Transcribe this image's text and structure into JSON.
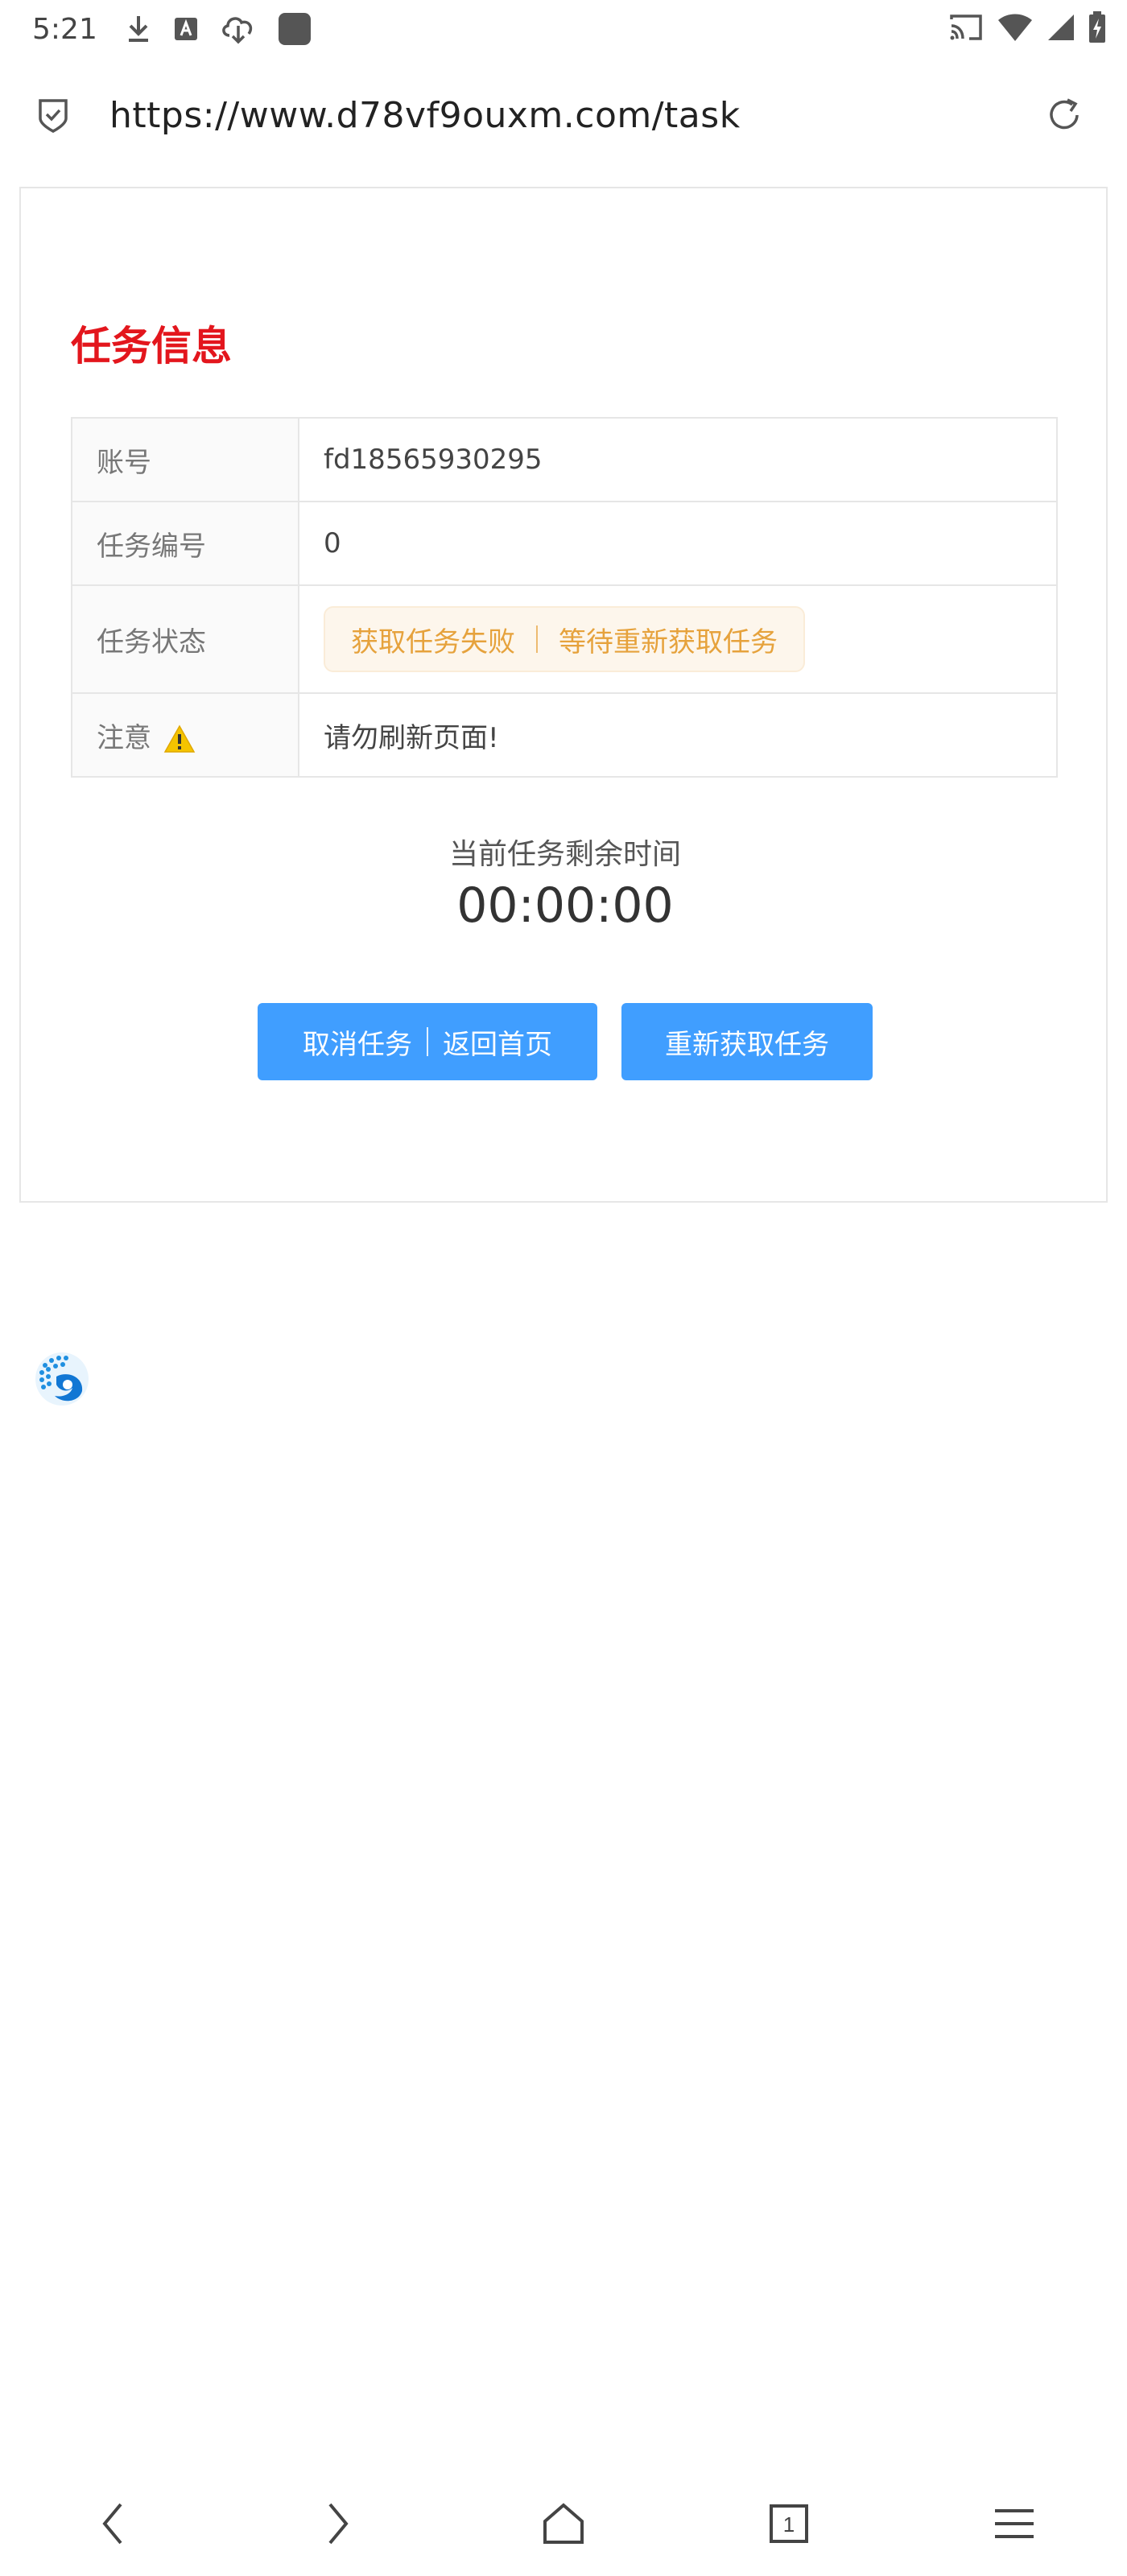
{
  "status_bar": {
    "time": "5:21",
    "left_icons": [
      "download-icon",
      "font-a-icon",
      "cloud-download-icon",
      "app-square-icon"
    ],
    "right_icons": [
      "cast-icon",
      "wifi-icon",
      "signal-icon",
      "battery-charging-icon"
    ]
  },
  "url_bar": {
    "url": "https://www.d78vf9ouxm.com/task",
    "left_icon": "shield-check-icon",
    "right_icon": "reload-icon"
  },
  "task": {
    "title": "任务信息",
    "rows": {
      "account": {
        "label": "账号",
        "value": "fd18565930295"
      },
      "task_no": {
        "label": "任务编号",
        "value": "0"
      },
      "status": {
        "label": "任务状态",
        "tag_left": "获取任务失败",
        "tag_right": "等待重新获取任务"
      },
      "notice": {
        "label": "注意",
        "value": "请勿刷新页面!"
      }
    },
    "remain_label": "当前任务剩余时间",
    "remain_time": "00:00:00",
    "buttons": {
      "cancel_left": "取消任务",
      "cancel_right": "返回首页",
      "retry": "重新获取任务"
    }
  },
  "colors": {
    "title_red": "#e3161d",
    "button_blue": "#409eff",
    "warning_tag_text": "#e6a23c",
    "warning_tag_bg": "#fdf6ec"
  },
  "bottom_nav": [
    "back-icon",
    "forward-icon",
    "home-icon",
    "tabs-icon",
    "menu-icon"
  ],
  "tab_count": "1"
}
